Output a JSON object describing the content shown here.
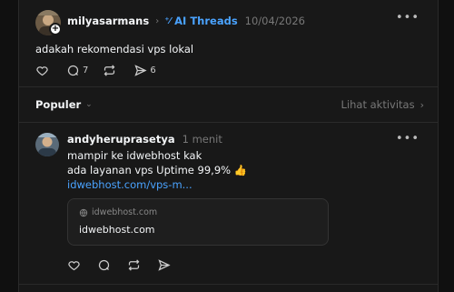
{
  "post": {
    "username": "milyasarmans",
    "topic": "AI Threads",
    "date": "10/04/2026",
    "text": "adakah rekomendasi vps lokal",
    "likes": "",
    "comments": "7",
    "reposts": "",
    "shares": "6",
    "more_icon": "ellipsis-icon"
  },
  "replies_header": {
    "sort_label": "Populer",
    "activity_label": "Lihat aktivitas"
  },
  "reply": {
    "username": "andyheruprasetya",
    "time": "1 menit",
    "line1": "mampir ke idwebhost kak",
    "line2": "ada layanan vps Uptime 99,9% 👍",
    "link": "idwebhost.com/vps-m...",
    "card": {
      "domain": "idwebhost.com",
      "title": "idwebhost.com"
    }
  },
  "colors": {
    "background": "#101010",
    "panel": "#181818",
    "accent": "#4aa3ff",
    "muted": "#777777"
  }
}
